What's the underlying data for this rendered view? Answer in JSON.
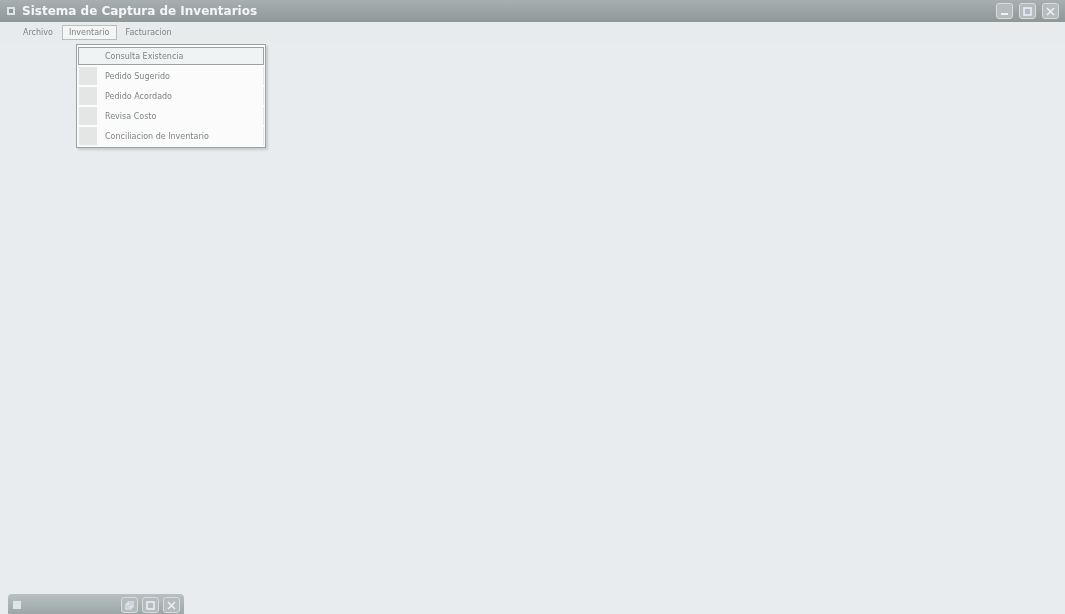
{
  "window": {
    "title": "Sistema de Captura de Inventarios"
  },
  "menu_bar": [
    {
      "label": "Archivo",
      "selected": false
    },
    {
      "label": "Inventario",
      "selected": true
    },
    {
      "label": "Facturacion",
      "selected": false
    }
  ],
  "dropdown": [
    {
      "label": "Consulta Existencia",
      "selected": true
    },
    {
      "label": "Pedido Sugerido",
      "selected": false
    },
    {
      "label": "Pedido Acordado",
      "selected": false
    },
    {
      "label": "Revisa Costo",
      "selected": false
    },
    {
      "label": "Conciliacion de Inventario",
      "selected": false
    }
  ]
}
